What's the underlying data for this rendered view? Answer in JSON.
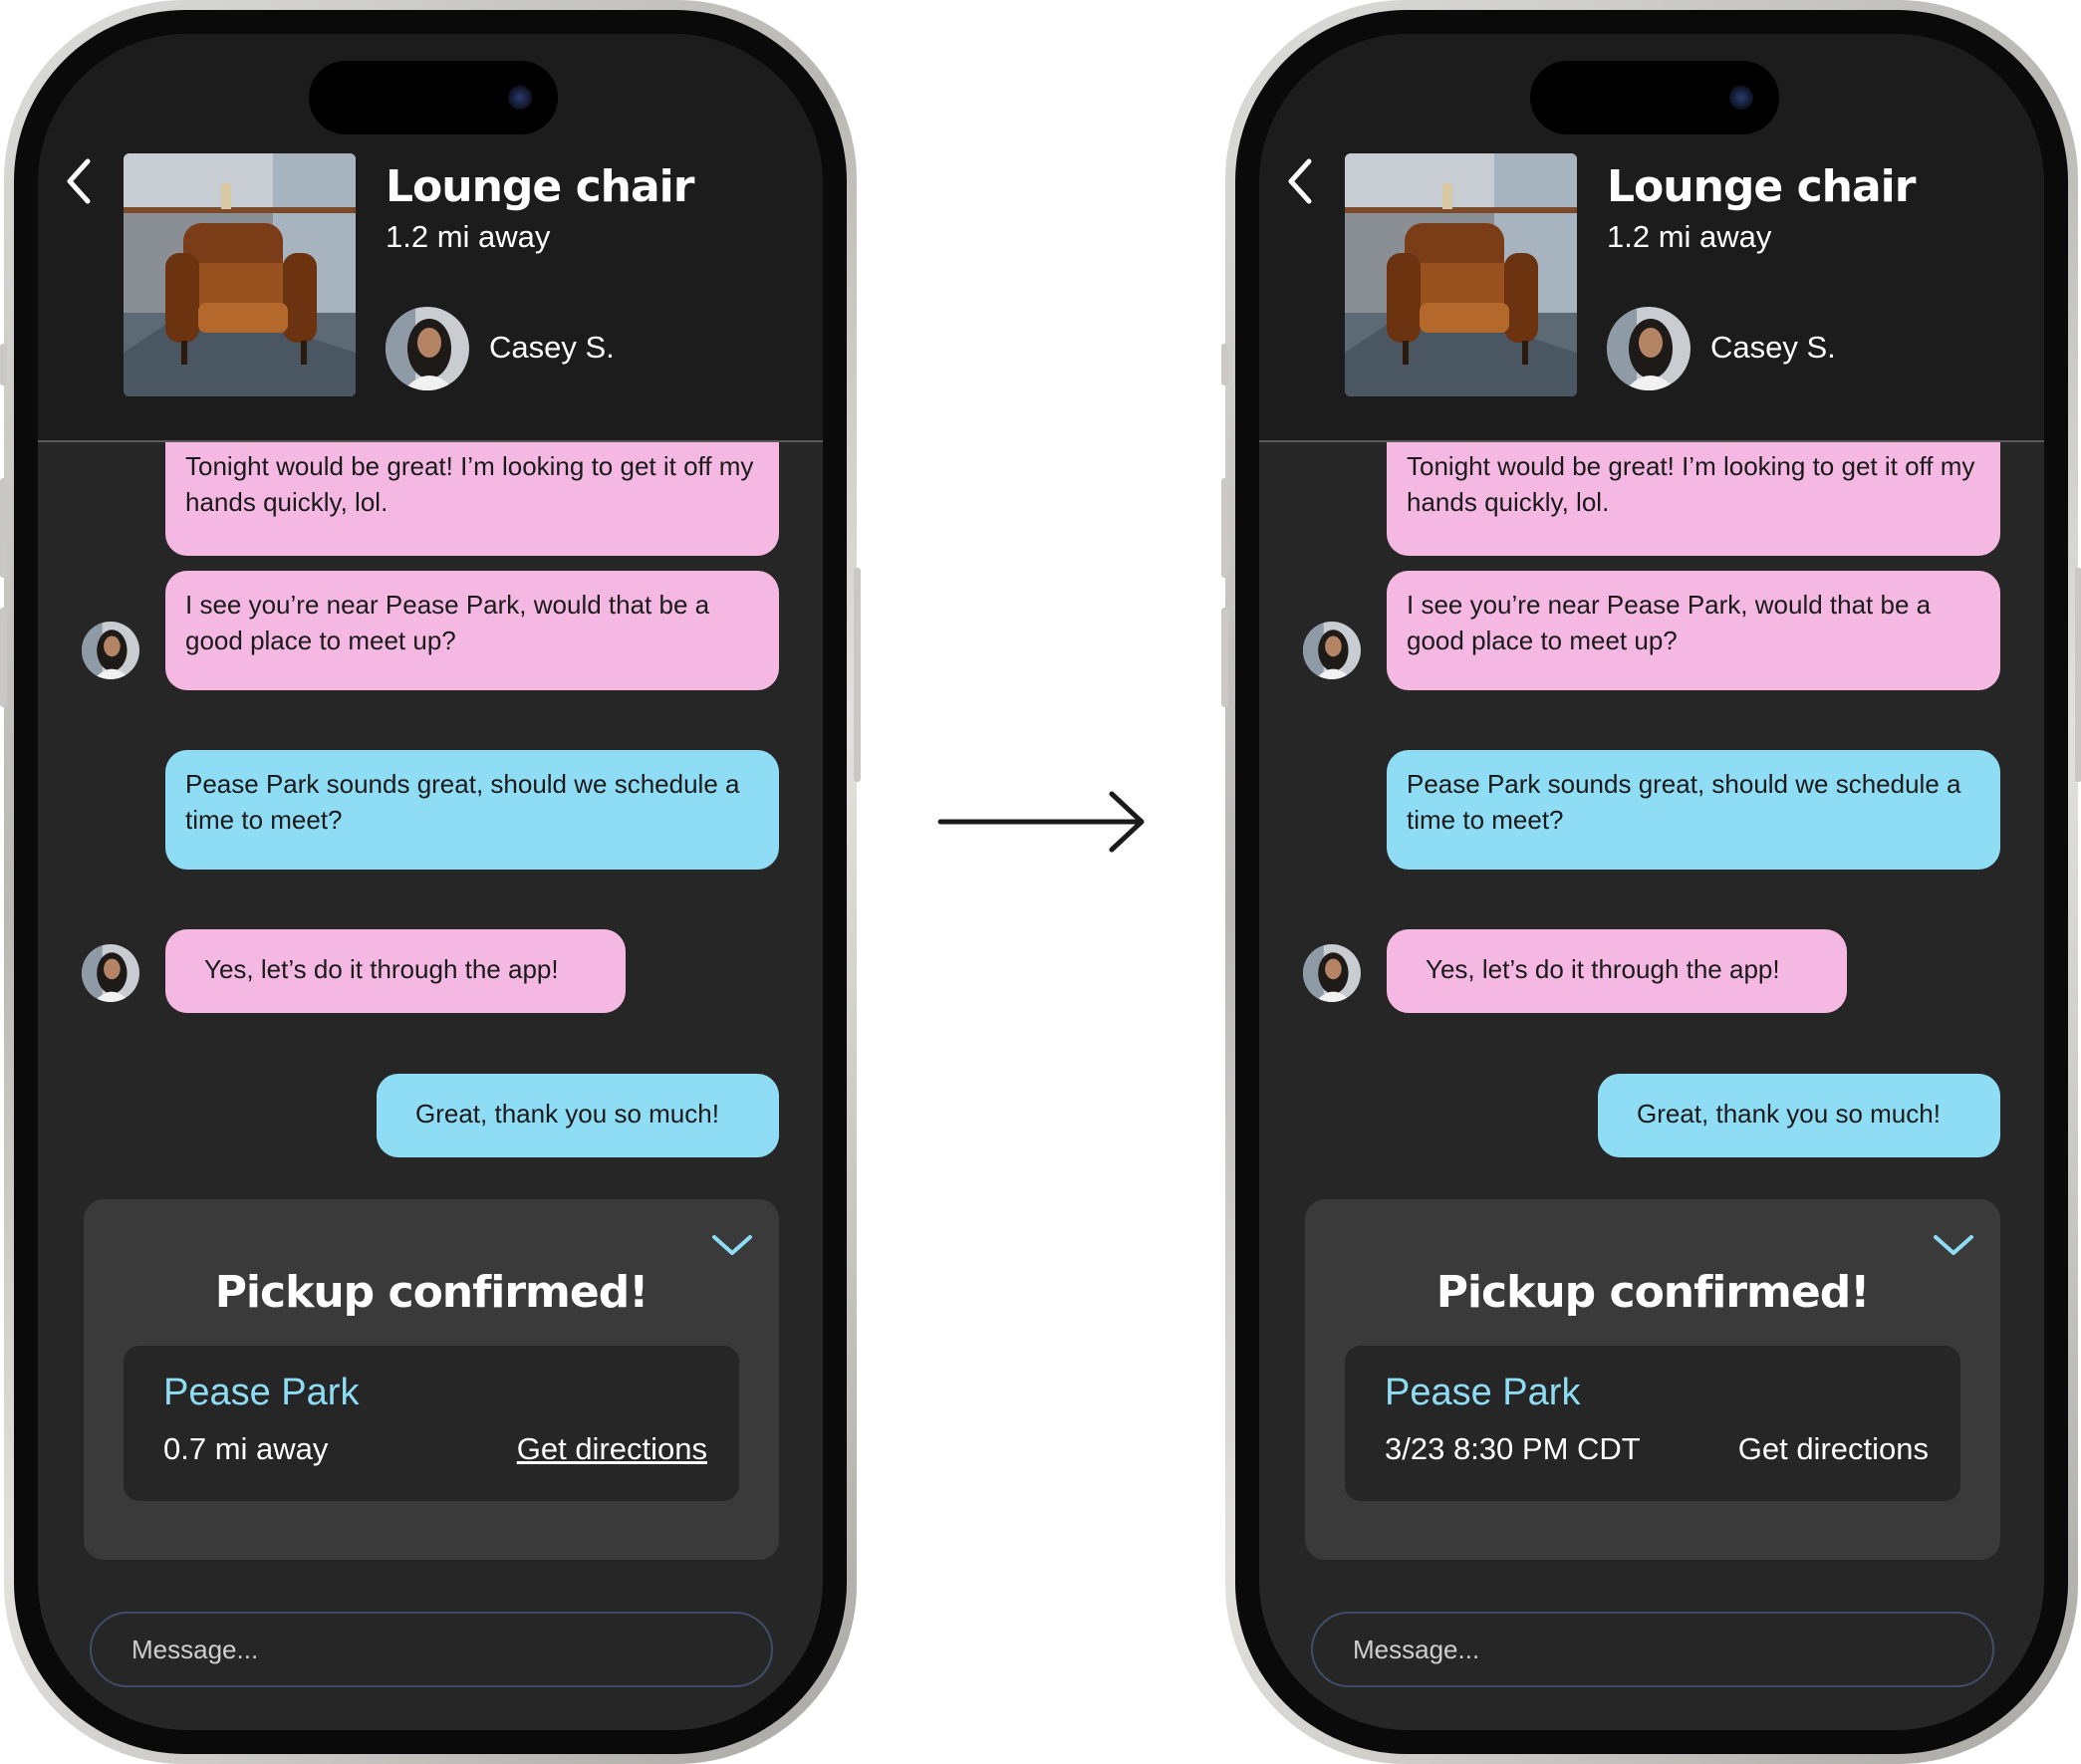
{
  "listing": {
    "title": "Lounge chair",
    "distance": "1.2 mi away",
    "seller_name": "Casey S."
  },
  "messages": [
    {
      "text": "Tonight would be great! I’m looking to get it off my hands quickly, lol.",
      "sender": "seller"
    },
    {
      "text": "I see you’re near Pease Park, would that be a good place to meet up?",
      "sender": "seller"
    },
    {
      "text": "Pease Park sounds great, should we schedule a time to meet?",
      "sender": "buyer"
    },
    {
      "text": "Yes, let’s do it through the app!",
      "sender": "seller"
    },
    {
      "text": "Great, thank you so much!",
      "sender": "buyer"
    }
  ],
  "before": {
    "card_title": "Pickup confirmed!",
    "location_name": "Pease Park",
    "location_detail": "0.7 mi away",
    "link_label": "Get directions"
  },
  "after": {
    "card_title": "Pickup confirmed!",
    "location_name": "Pease Park",
    "location_detail": "3/23 8:30 PM CDT",
    "link_label": "Get directions"
  },
  "input": {
    "placeholder": "Message..."
  },
  "colors": {
    "screen_bg": "#262626",
    "header_bg": "#1c1c1c",
    "seller_bubble": "#f5b8e3",
    "buyer_bubble": "#8fdcf5",
    "card_bg": "#3a3a3a",
    "accent": "#8fdcf5"
  },
  "icons": {
    "back": "chevron-left-icon",
    "collapse": "chevron-down-icon",
    "transition": "arrow-right-icon"
  }
}
